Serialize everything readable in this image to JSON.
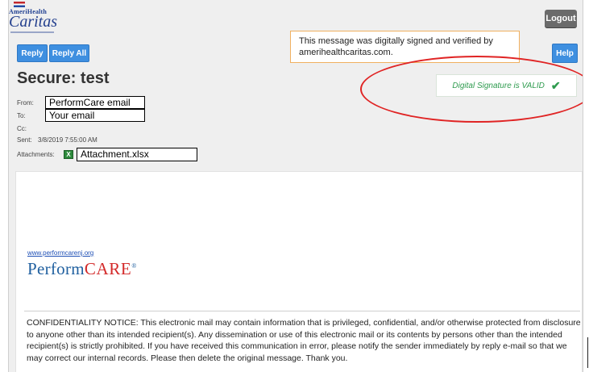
{
  "logo": {
    "brand": "AmeriHealth",
    "name": "Caritas"
  },
  "header": {
    "logout_label": "Logout"
  },
  "toolbar": {
    "reply_label": "Reply",
    "reply_all_label": "Reply All",
    "help_label": "Help"
  },
  "tooltip": {
    "text": "This message was digitally signed and verified by amerihealthcaritas.com."
  },
  "message": {
    "subject": "Secure: test",
    "from_label": "From:",
    "from_value": "PerformCare email",
    "to_label": "To:",
    "to_value": "Your email",
    "cc_label": "Cc:",
    "sent_label": "Sent:",
    "sent_value": "3/8/2019 7:55:00 AM",
    "attachments_label": "Attachments:",
    "attachment_name": "Attachment.xlsx"
  },
  "signature": {
    "text": "Digital Signature is VALID",
    "check": "✔"
  },
  "body": {
    "link_text": "www.performcarenj.org",
    "logo_perform": "Perform",
    "logo_care": "CARE",
    "logo_mark": "®",
    "notice": "CONFIDENTIALITY NOTICE: This electronic mail may contain information that is privileged, confidential, and/or otherwise protected from disclosure to anyone other than its intended recipient(s). Any dissemination or use of this electronic mail or its contents by persons other than the intended recipient(s) is strictly prohibited. If you have received this communication in error, please notify the sender immediately by reply e-mail so that we may correct our internal records. Please then delete the original message. Thank you."
  },
  "colors": {
    "accent_blue": "#3e8fe0",
    "valid_green": "#2e9b4e",
    "highlight_red": "#e02424",
    "tooltip_border": "#f0b060"
  }
}
